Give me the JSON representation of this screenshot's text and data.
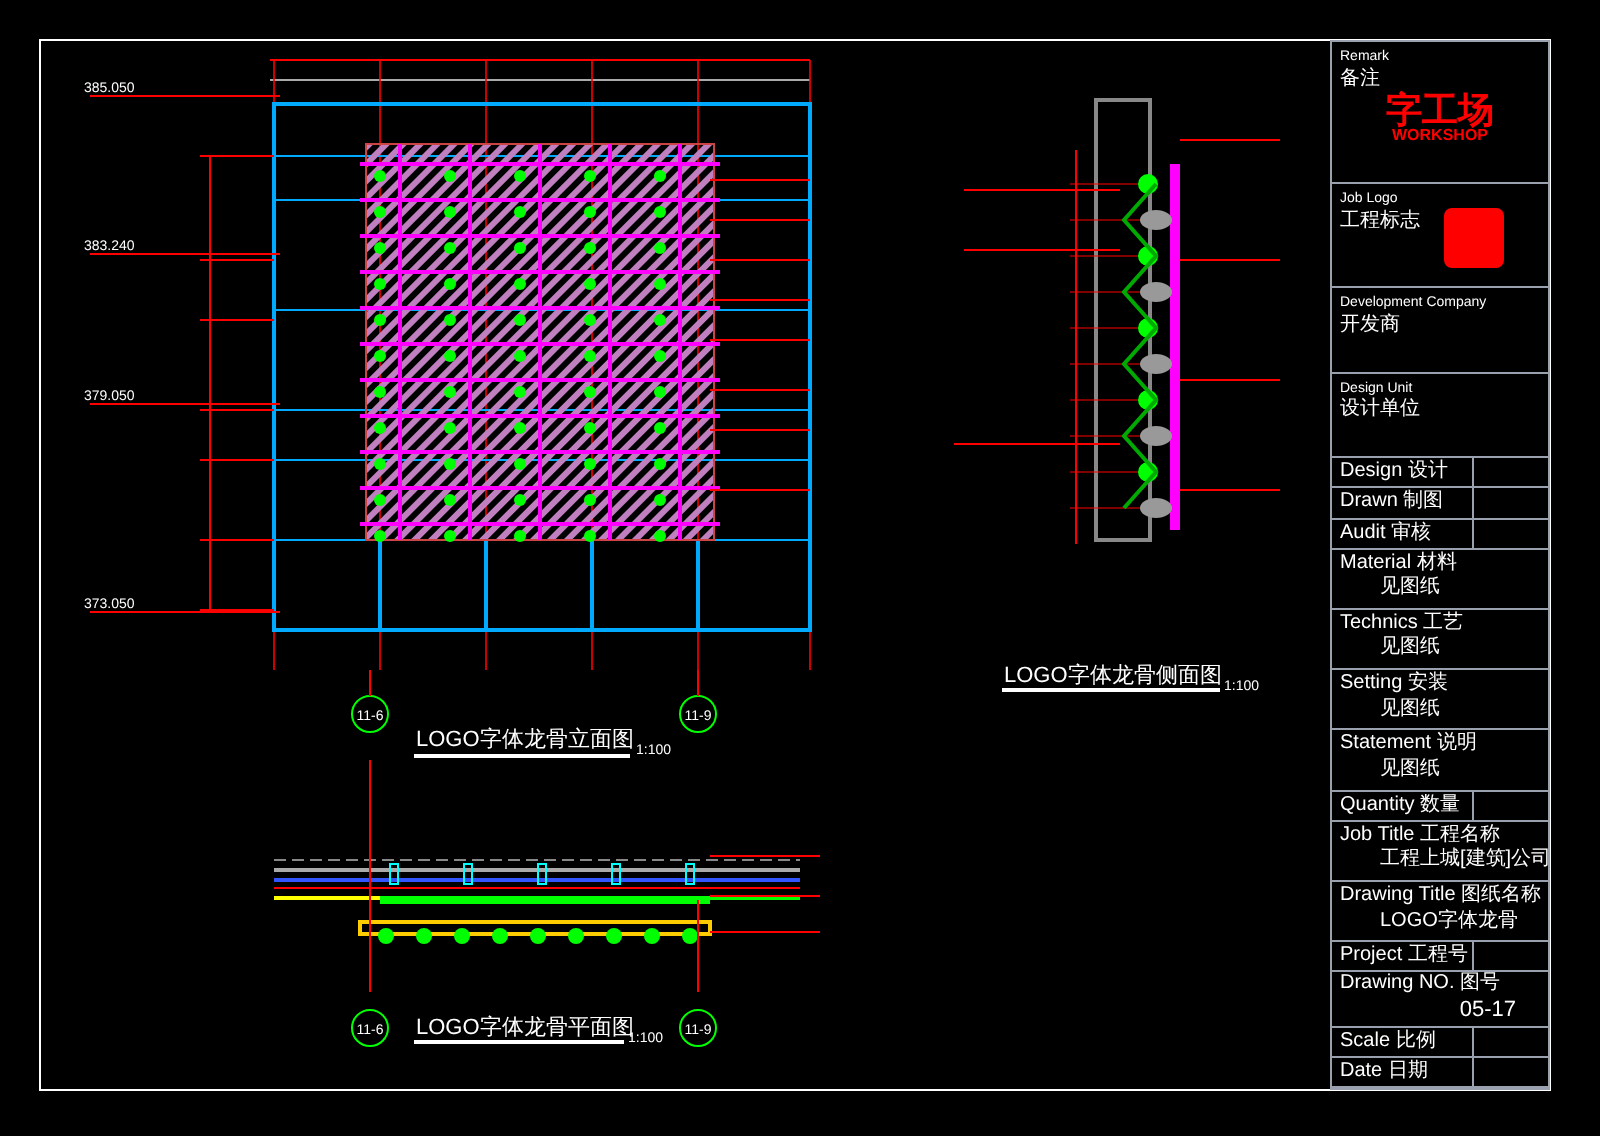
{
  "elevation": {
    "title": "LOGO字体龙骨立面图",
    "scale": "1:100",
    "axes": [
      "11-6",
      "11-9"
    ],
    "levels": [
      "385.050",
      "383.240",
      "379.050",
      "373.050"
    ]
  },
  "side_section": {
    "title": "LOGO字体龙骨侧面图",
    "scale": "1:100"
  },
  "plan": {
    "title": "LOGO字体龙骨平面图",
    "scale": "1:100",
    "axes": [
      "11-6",
      "11-9"
    ]
  },
  "title_block": [
    {
      "kind": "logo",
      "label": "Remark",
      "sub": "备注",
      "logo": "字工场",
      "logo_sub": "WORKSHOP"
    },
    {
      "kind": "stamp",
      "label": "Job Logo",
      "sub": "工程标志"
    },
    {
      "kind": "text",
      "label": "Development Company",
      "sub": "开发商"
    },
    {
      "kind": "text",
      "label": "Design Unit",
      "sub": "设计单位"
    },
    {
      "kind": "pair",
      "label": "Design 设计"
    },
    {
      "kind": "pair",
      "label": "Drawn 制图"
    },
    {
      "kind": "pair",
      "label": "Audit 审核"
    },
    {
      "kind": "value",
      "label": "Material 材料",
      "value": "见图纸"
    },
    {
      "kind": "value",
      "label": "Technics 工艺",
      "value": "见图纸"
    },
    {
      "kind": "value",
      "label": "Setting 安装",
      "value": "见图纸"
    },
    {
      "kind": "value",
      "label": "Statement 说明",
      "value": "见图纸"
    },
    {
      "kind": "pair",
      "label": "Quantity 数量"
    },
    {
      "kind": "value",
      "label": "Job Title 工程名称",
      "value": "工程上城[建筑]公司"
    },
    {
      "kind": "value",
      "label": "Drawing Title 图纸名称",
      "value": "LOGO字体龙骨"
    },
    {
      "kind": "pair",
      "label": "Project 工程号"
    },
    {
      "kind": "number",
      "label": "Drawing NO. 图号",
      "value": "05-17"
    },
    {
      "kind": "pair",
      "label": "Scale 比例"
    },
    {
      "kind": "pair",
      "label": "Date 日期"
    }
  ]
}
